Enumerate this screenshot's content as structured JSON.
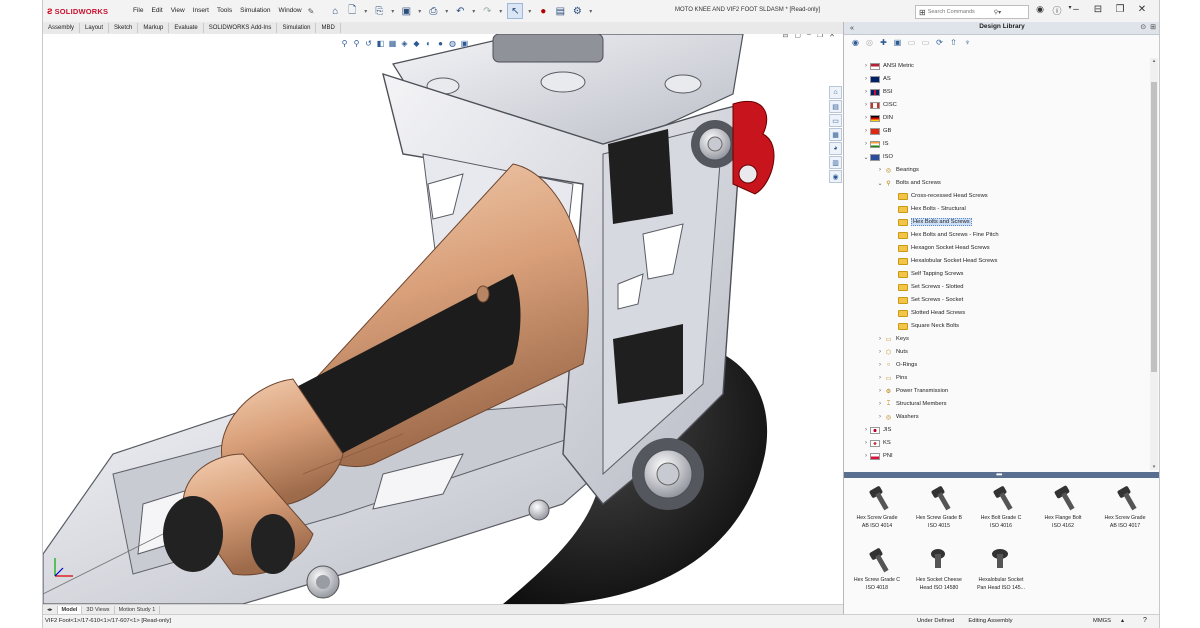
{
  "app": {
    "logo_mark": "ƨ",
    "logo_text": "SOLIDWORKS",
    "document_title": "MOTO KNEE AND VIF2 FOOT SLDASM * [Read-only]"
  },
  "menus": [
    "File",
    "Edit",
    "View",
    "Insert",
    "Tools",
    "Simulation",
    "Window"
  ],
  "search": {
    "placeholder": "Search Commands"
  },
  "command_tabs": [
    "Assembly",
    "Layout",
    "Sketch",
    "Markup",
    "Evaluate",
    "SOLIDWORKS Add-Ins",
    "Simulation",
    "MBD"
  ],
  "design_library": {
    "title": "Design Library",
    "tree": [
      {
        "label": "ANSI Metric",
        "flag": "us"
      },
      {
        "label": "AS",
        "flag": "au"
      },
      {
        "label": "BSI",
        "flag": "gb"
      },
      {
        "label": "CISC",
        "flag": "ca"
      },
      {
        "label": "DIN",
        "flag": "de"
      },
      {
        "label": "GB",
        "flag": "cn"
      },
      {
        "label": "IS",
        "flag": "in"
      },
      {
        "label": "ISO",
        "flag": "iso"
      },
      {
        "label": "Bearings"
      },
      {
        "label": "Bolts and Screws"
      },
      {
        "label": "Cross-recessed Head Screws"
      },
      {
        "label": "Hex Bolts - Structural"
      },
      {
        "label": "Hex Bolts and Screws"
      },
      {
        "label": "Hex Bolts and Screws - Fine Pitch"
      },
      {
        "label": "Hexagon Socket Head Screws"
      },
      {
        "label": "Hexalobular Socket Head Screws"
      },
      {
        "label": "Self Tapping Screws"
      },
      {
        "label": "Set Screws - Slotted"
      },
      {
        "label": "Set Screws - Socket"
      },
      {
        "label": "Slotted Head Screws"
      },
      {
        "label": "Square Neck Bolts"
      },
      {
        "label": "Keys"
      },
      {
        "label": "Nuts"
      },
      {
        "label": "O-Rings"
      },
      {
        "label": "Pins"
      },
      {
        "label": "Power Transmission"
      },
      {
        "label": "Structural Members"
      },
      {
        "label": "Washers"
      },
      {
        "label": "JIS",
        "flag": "jp"
      },
      {
        "label": "KS",
        "flag": "kr"
      },
      {
        "label": "PNI",
        "flag": "pl"
      }
    ],
    "items": [
      {
        "line1": "Hex Screw Grade",
        "line2": "AB ISO 4014"
      },
      {
        "line1": "Hex Screw Grade B",
        "line2": "ISO 4015"
      },
      {
        "line1": "Hex Bolt Grade C",
        "line2": "ISO 4016"
      },
      {
        "line1": "Hex Flange Bolt",
        "line2": "ISO 4162"
      },
      {
        "line1": "Hex Screw Grade",
        "line2": "AB ISO 4017"
      },
      {
        "line1": "Hex Screw Grade C",
        "line2": "ISO 4018"
      },
      {
        "line1": "Hex Socket Cheese",
        "line2": "Head ISO 14580"
      },
      {
        "line1": "Hexalobular Socket",
        "line2": "Pan Head ISO 145..."
      }
    ]
  },
  "sheet_tabs": [
    "Model",
    "3D Views",
    "Motion Study 1"
  ],
  "status": {
    "path": "VIF2 Foot<1>/17-610<1>/17-607<1> [Read-only]",
    "fully_defined": "Under Defined",
    "editing": "Editing Assembly",
    "units": "MMGS",
    "units_arrow": "▴",
    "help": "?"
  },
  "colors": {
    "accent": "#c8102e",
    "selection": "#cde0f7",
    "splitter": "#5a6f8f",
    "bronze": "#d9a07a",
    "rubber": "#1e1e1e",
    "aluminum": "#dcdde3",
    "red_part": "#c8141c"
  }
}
